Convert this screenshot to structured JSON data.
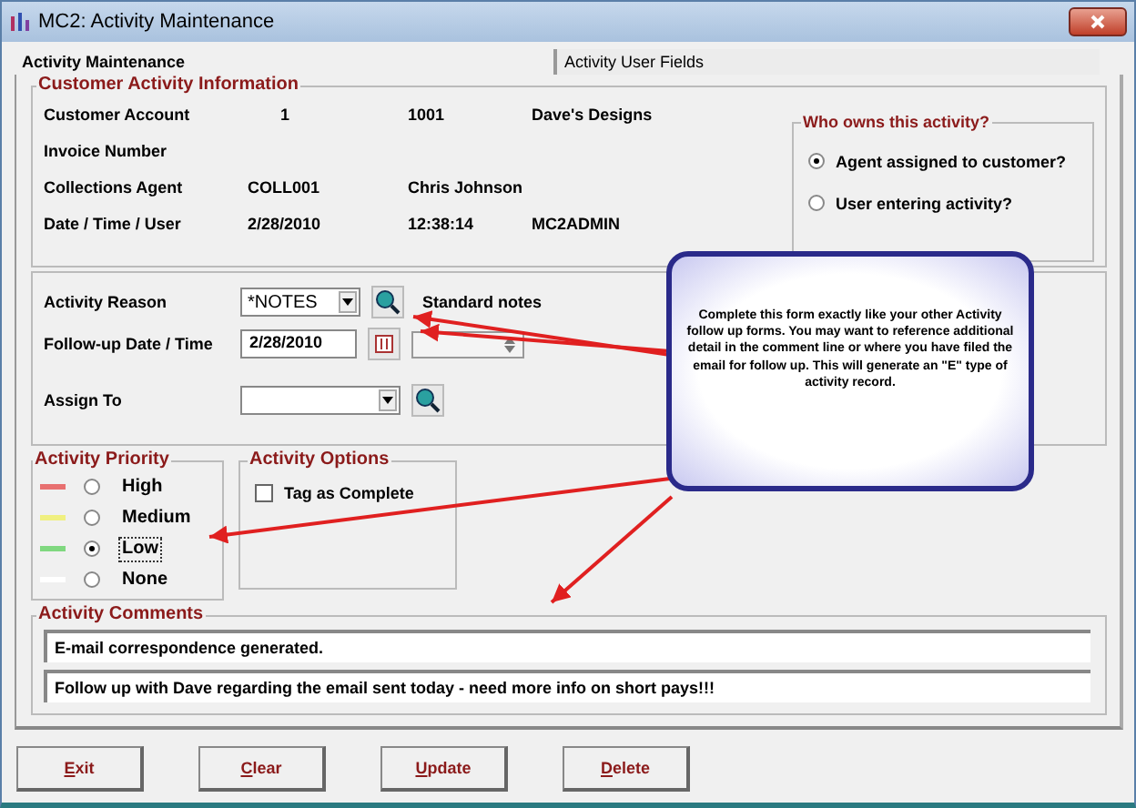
{
  "window": {
    "title": "MC2: Activity Maintenance"
  },
  "tabs": [
    {
      "label": "Activity Maintenance",
      "selected": true
    },
    {
      "label": "Activity User Fields",
      "selected": false
    }
  ],
  "customer_info": {
    "title": "Customer Activity Information",
    "rows": [
      {
        "label": "Customer Account",
        "values": [
          "1",
          "1001",
          "Dave's Designs"
        ]
      },
      {
        "label": "Invoice Number",
        "values": []
      },
      {
        "label": "Collections Agent",
        "values": [
          "COLL001",
          "Chris Johnson"
        ]
      },
      {
        "label": "Date / Time / User",
        "values": [
          "2/28/2010",
          "12:38:14",
          "MC2ADMIN"
        ]
      }
    ]
  },
  "owner": {
    "title": "Who owns this activity?",
    "options": [
      {
        "label": "Agent assigned to customer?",
        "selected": true
      },
      {
        "label": "User entering activity?",
        "selected": false
      }
    ]
  },
  "activity_reason": {
    "label": "Activity Reason",
    "value": "*NOTES",
    "description": "Standard notes"
  },
  "follow_up": {
    "label": "Follow-up Date / Time",
    "date": "2/28/2010"
  },
  "assign_to": {
    "label": "Assign To"
  },
  "priority": {
    "title": "Activity Priority",
    "options": [
      {
        "label": "High",
        "color": "#e87070",
        "selected": false
      },
      {
        "label": "Medium",
        "color": "#f0f080",
        "selected": false
      },
      {
        "label": "Low",
        "color": "#80d880",
        "selected": true
      },
      {
        "label": "None",
        "color": "#ffffff",
        "selected": false
      }
    ]
  },
  "options": {
    "title": "Activity Options",
    "items": [
      {
        "label": "Tag as Complete",
        "checked": false
      }
    ]
  },
  "comments": {
    "title": "Activity Comments",
    "lines": [
      "E-mail correspondence generated.",
      "Follow up with Dave regarding the email sent today - need more info on short pays!!!"
    ]
  },
  "callout": {
    "text": "Complete this form exactly like your other Activity follow up forms.  You may want to reference additional detail in the comment line or where you have filed the email for follow up. This will generate an \"E\" type of activity record."
  },
  "buttons": [
    {
      "label": "Exit"
    },
    {
      "label": "Clear"
    },
    {
      "label": "Update"
    },
    {
      "label": "Delete"
    }
  ]
}
